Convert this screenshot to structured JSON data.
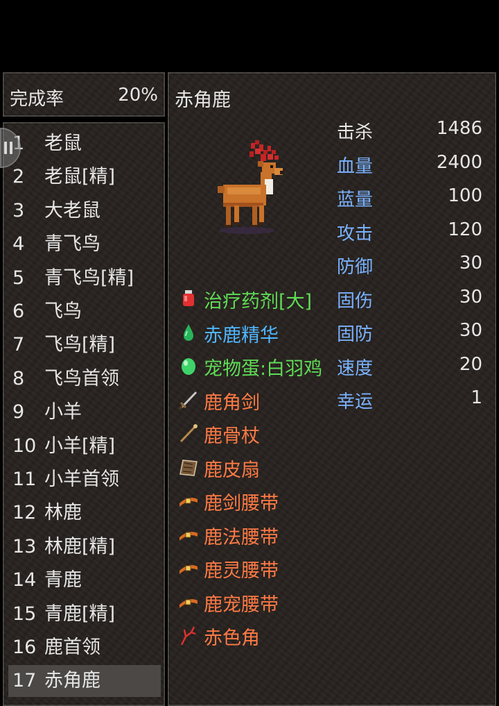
{
  "header": {
    "completion_label": "完成率",
    "completion_value": "20%"
  },
  "monster_list": [
    {
      "num": "1",
      "name": "老鼠"
    },
    {
      "num": "2",
      "name": "老鼠[精]"
    },
    {
      "num": "3",
      "name": "大老鼠"
    },
    {
      "num": "4",
      "name": "青飞鸟"
    },
    {
      "num": "5",
      "name": "青飞鸟[精]"
    },
    {
      "num": "6",
      "name": "飞鸟"
    },
    {
      "num": "7",
      "name": "飞鸟[精]"
    },
    {
      "num": "8",
      "name": "飞鸟首领"
    },
    {
      "num": "9",
      "name": "小羊"
    },
    {
      "num": "10",
      "name": "小羊[精]"
    },
    {
      "num": "11",
      "name": "小羊首领"
    },
    {
      "num": "12",
      "name": "林鹿"
    },
    {
      "num": "13",
      "name": "林鹿[精]"
    },
    {
      "num": "14",
      "name": "青鹿"
    },
    {
      "num": "15",
      "name": "青鹿[精]"
    },
    {
      "num": "16",
      "name": "鹿首领"
    },
    {
      "num": "17",
      "name": "赤角鹿"
    }
  ],
  "selected_index": 16,
  "detail": {
    "name": "赤角鹿",
    "stats": [
      {
        "label": "击杀",
        "value": "1486",
        "color": "#e6e6e6"
      },
      {
        "label": "血量",
        "value": "2400",
        "color": "#7ab2ff"
      },
      {
        "label": "蓝量",
        "value": "100",
        "color": "#7ab2ff"
      },
      {
        "label": "攻击",
        "value": "120",
        "color": "#7ab2ff"
      },
      {
        "label": "防御",
        "value": "30",
        "color": "#7ab2ff"
      },
      {
        "label": "固伤",
        "value": "30",
        "color": "#7ab2ff"
      },
      {
        "label": "固防",
        "value": "30",
        "color": "#7ab2ff"
      },
      {
        "label": "速度",
        "value": "20",
        "color": "#7ab2ff"
      },
      {
        "label": "幸运",
        "value": "1",
        "color": "#7ab2ff"
      }
    ],
    "drops": [
      {
        "name": "治疗药剂[大]",
        "color": "#5fdc56",
        "icon": "potion-icon"
      },
      {
        "name": "赤鹿精华",
        "color": "#4fb6ff",
        "icon": "essence-drop-icon"
      },
      {
        "name": "宠物蛋:白羽鸡",
        "color": "#5fdc56",
        "icon": "pet-egg-icon"
      },
      {
        "name": "鹿角剑",
        "color": "#ff7a45",
        "icon": "sword-icon"
      },
      {
        "name": "鹿骨杖",
        "color": "#ff7a45",
        "icon": "staff-icon"
      },
      {
        "name": "鹿皮扇",
        "color": "#ff7a45",
        "icon": "fan-icon"
      },
      {
        "name": "鹿剑腰带",
        "color": "#ff7a45",
        "icon": "belt-icon"
      },
      {
        "name": "鹿法腰带",
        "color": "#ff7a45",
        "icon": "belt-icon"
      },
      {
        "name": "鹿灵腰带",
        "color": "#ff7a45",
        "icon": "belt-icon"
      },
      {
        "name": "鹿宠腰带",
        "color": "#ff7a45",
        "icon": "belt-icon"
      },
      {
        "name": "赤色角",
        "color": "#ff7a45",
        "icon": "red-antler-icon"
      }
    ]
  }
}
